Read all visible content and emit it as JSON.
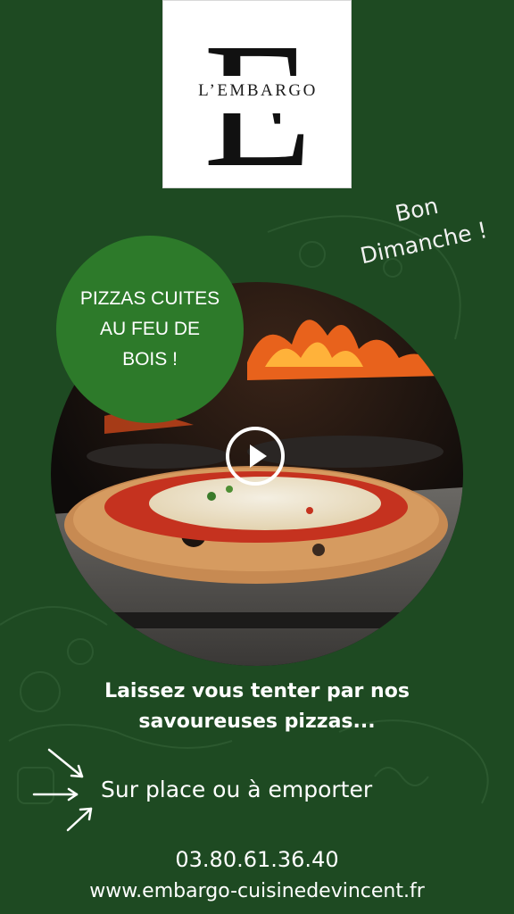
{
  "logo": {
    "letter": "E",
    "name": "L’EMBARGO"
  },
  "greeting": {
    "line1": "Bon",
    "line2": "Dimanche !"
  },
  "badge": {
    "line1": "PIZZAS CUITES",
    "line2": "AU FEU DE",
    "line3": "BOIS !"
  },
  "video": {
    "play_icon": "play-icon",
    "subject": "pizza-in-wood-fired-oven"
  },
  "tagline": {
    "line1": "Laissez vous tenter par nos",
    "line2": "savoureuses pizzas..."
  },
  "service": {
    "arrows_icon": "arrows-icon",
    "text": "Sur place ou à emporter"
  },
  "contact": {
    "phone": "03.80.61.36.40",
    "website": "www.embargo-cuisinedevincent.fr"
  },
  "colors": {
    "background": "#1e4a22",
    "badge": "#2d7a2a",
    "text": "#ffffff"
  }
}
